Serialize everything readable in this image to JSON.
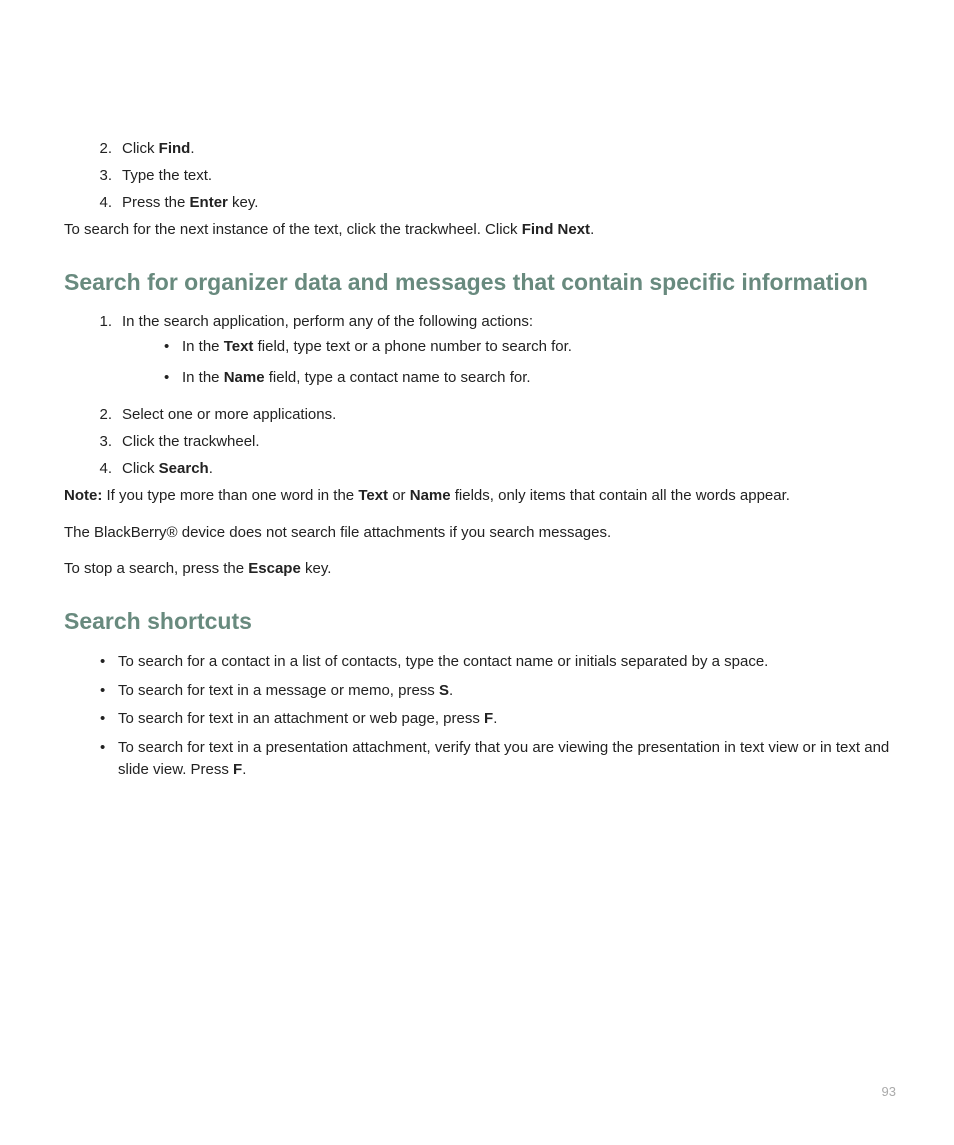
{
  "intro_steps": [
    {
      "n": "2.",
      "pre": "Click ",
      "bold": "Find",
      "post": "."
    },
    {
      "n": "3.",
      "pre": "Type the text.",
      "bold": "",
      "post": ""
    },
    {
      "n": "4.",
      "pre": "Press the ",
      "bold": "Enter",
      "post": " key."
    }
  ],
  "intro_para_pre": "To search for the next instance of the text, click the trackwheel. Click ",
  "intro_para_bold": "Find Next",
  "intro_para_post": ".",
  "heading1": "Search for organizer data and messages that contain specific information",
  "s1_step1": {
    "n": "1.",
    "text": "In the search application, perform any of the following actions:"
  },
  "s1_sub": [
    {
      "pre": "In the ",
      "b": "Text",
      "post": " field, type text or a phone number to search for."
    },
    {
      "pre": "In the ",
      "b": "Name",
      "post": " field, type a contact name to search for."
    }
  ],
  "s1_rest": [
    {
      "n": "2.",
      "pre": "Select one or more applications.",
      "b": "",
      "post": ""
    },
    {
      "n": "3.",
      "pre": "Click the trackwheel.",
      "b": "",
      "post": ""
    },
    {
      "n": "4.",
      "pre": "Click ",
      "b": "Search",
      "post": "."
    }
  ],
  "note_label": "Note:",
  "note_seg1": "  If you type more than one word in the ",
  "note_b1": "Text",
  "note_seg2": " or ",
  "note_b2": "Name",
  "note_seg3": " fields, only items that contain all the words appear.",
  "para_device": "The BlackBerry® device does not search file attachments if you search messages.",
  "stop_pre": "To stop a search, press the ",
  "stop_b": "Escape",
  "stop_post": " key.",
  "heading2": "Search shortcuts",
  "shortcuts": [
    {
      "pre": "To search for a contact in a list of contacts, type the contact name or initials separated by a space.",
      "b": "",
      "post": ""
    },
    {
      "pre": "To search for text in a message or memo, press ",
      "b": "S",
      "post": "."
    },
    {
      "pre": "To search for text in an attachment or web page, press ",
      "b": "F",
      "post": "."
    },
    {
      "pre": "To search for text in a presentation attachment, verify that you are viewing the presentation in text view or in text and slide view. Press ",
      "b": "F",
      "post": "."
    }
  ],
  "page_number": "93"
}
